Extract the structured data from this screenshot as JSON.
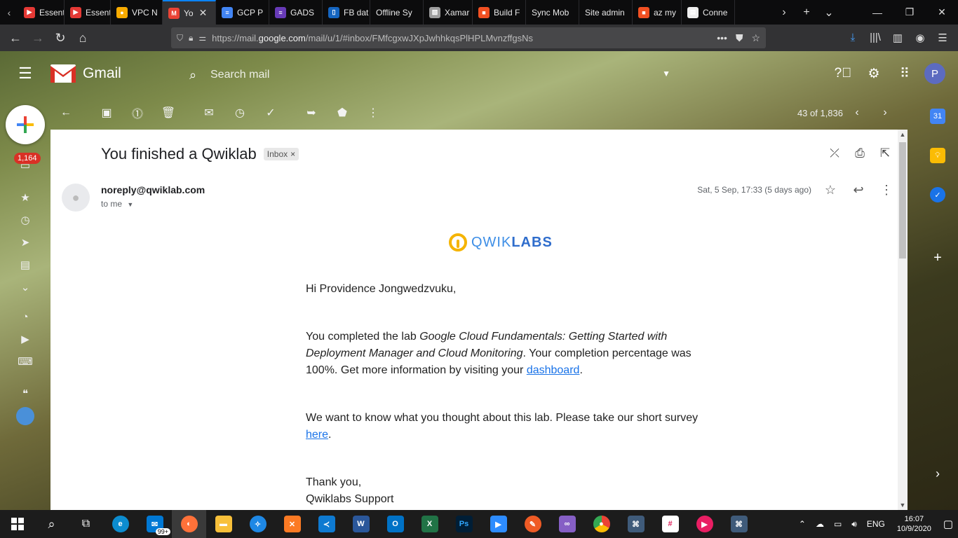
{
  "browser": {
    "tabs": [
      {
        "label": "Essent",
        "color": "#e53935",
        "glyph": "▶"
      },
      {
        "label": "Essent",
        "color": "#e53935",
        "glyph": "▶"
      },
      {
        "label": "VPC N",
        "color": "#f9ab00",
        "glyph": "●"
      },
      {
        "label": "Yo",
        "color": "#ea4335",
        "glyph": "M",
        "active": true
      },
      {
        "label": "GCP P",
        "color": "#4285f4",
        "glyph": "≡"
      },
      {
        "label": "GADS",
        "color": "#673ab7",
        "glyph": "≡"
      },
      {
        "label": "FB dat",
        "color": "#1565c0",
        "glyph": "▯"
      },
      {
        "label": "Offline Sy",
        "color": "",
        "glyph": ""
      },
      {
        "label": "Xamar",
        "color": "#9e9e9e",
        "glyph": "▧"
      },
      {
        "label": "Build F",
        "color": "#f25022",
        "glyph": "■"
      },
      {
        "label": "Sync Mob",
        "color": "",
        "glyph": ""
      },
      {
        "label": "Site admin",
        "color": "",
        "glyph": ""
      },
      {
        "label": "az my",
        "color": "#f25022",
        "glyph": "■"
      },
      {
        "label": "Conne",
        "color": "#eeeeee",
        "glyph": "▤"
      }
    ],
    "url_prefix": "https://mail.",
    "url_domain": "google.com",
    "url_suffix": "/mail/u/1/#inbox/FMfcgxwJXpJwhhkqsPlHPLMvnzffgsNs"
  },
  "gmail": {
    "app_name": "Gmail",
    "search_placeholder": "Search mail",
    "avatar_letter": "P",
    "unread_count": "1,164",
    "pager_text": "43 of 1,836"
  },
  "email": {
    "subject": "You finished a Qwiklab",
    "label": "Inbox",
    "label_close": "×",
    "sender": "noreply@qwiklab.com",
    "recipient": "to me",
    "date": "Sat, 5 Sep, 17:33 (5 days ago)",
    "brand_light": "QWIK",
    "brand_bold": "LABS",
    "greeting": "Hi Providence Jongwedzvuku,",
    "p1_a": "You completed the lab ",
    "p1_lab": "Google Cloud Fundamentals: Getting Started with Deployment Manager and Cloud Monitoring",
    "p1_b": ". Your completion percentage was 100%. Get more information by visiting your ",
    "p1_link": "dashboard",
    "p1_end": ".",
    "p2_a": "We want to know what you thought about this lab. Please take our short survey ",
    "p2_link": "here",
    "p2_end": ".",
    "closing": "Thank you,",
    "signature": "Qwiklabs Support"
  },
  "side_panel": {
    "calendar_text": "31"
  },
  "taskbar": {
    "mail_badge": "99+",
    "lang": "ENG",
    "time": "16:07",
    "date": "10/9/2020"
  }
}
